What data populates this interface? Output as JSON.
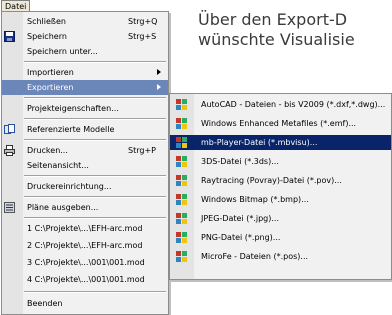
{
  "menubar": {
    "file_label": "Datei"
  },
  "background_text": {
    "line1": "Über den Export-D",
    "line2": "wünschte Visualisie"
  },
  "file_menu": {
    "items": [
      {
        "label": "Schließen",
        "shortcut": "Strg+Q"
      },
      {
        "label": "Speichern",
        "shortcut": "Strg+S"
      },
      {
        "label": "Speichern unter..."
      },
      {
        "label": "Importieren"
      },
      {
        "label": "Exportieren"
      },
      {
        "label": "Projekteigenschaften..."
      },
      {
        "label": "Referenzierte Modelle"
      },
      {
        "label": "Drucken...",
        "shortcut": "Strg+P"
      },
      {
        "label": "Seitenansicht..."
      },
      {
        "label": "Druckereinrichtung..."
      },
      {
        "label": "Pläne ausgeben..."
      },
      {
        "label": "1 C:\\Projekte\\...\\EFH-arc.mod"
      },
      {
        "label": "2 C:\\Projekte\\...\\EFH-arc.mod"
      },
      {
        "label": "3 C:\\Projekte\\...\\001\\001.mod"
      },
      {
        "label": "4 C:\\Projekte\\...\\001\\001.mod"
      },
      {
        "label": "Beenden"
      }
    ]
  },
  "export_menu": {
    "items": [
      {
        "label": "AutoCAD - Dateien - bis V2009 (*.dxf,*.dwg)..."
      },
      {
        "label": "Windows Enhanced Metafiles (*.emf)..."
      },
      {
        "label": "mb-Player-Datei (*.mbvisu)..."
      },
      {
        "label": "3DS-Datei (*.3ds)..."
      },
      {
        "label": "Raytracing (Povray)-Datei (*.pov)..."
      },
      {
        "label": "Windows Bitmap (*.bmp)..."
      },
      {
        "label": "JPEG-Datei (*.jpg)..."
      },
      {
        "label": "PNG-Datei (*.png)..."
      },
      {
        "label": "MicroFe - Dateien (*.pos)..."
      }
    ]
  },
  "colors": {
    "highlight": "#6b86b8",
    "selected": "#0a246a",
    "menu_bg": "#f1f1f1"
  }
}
